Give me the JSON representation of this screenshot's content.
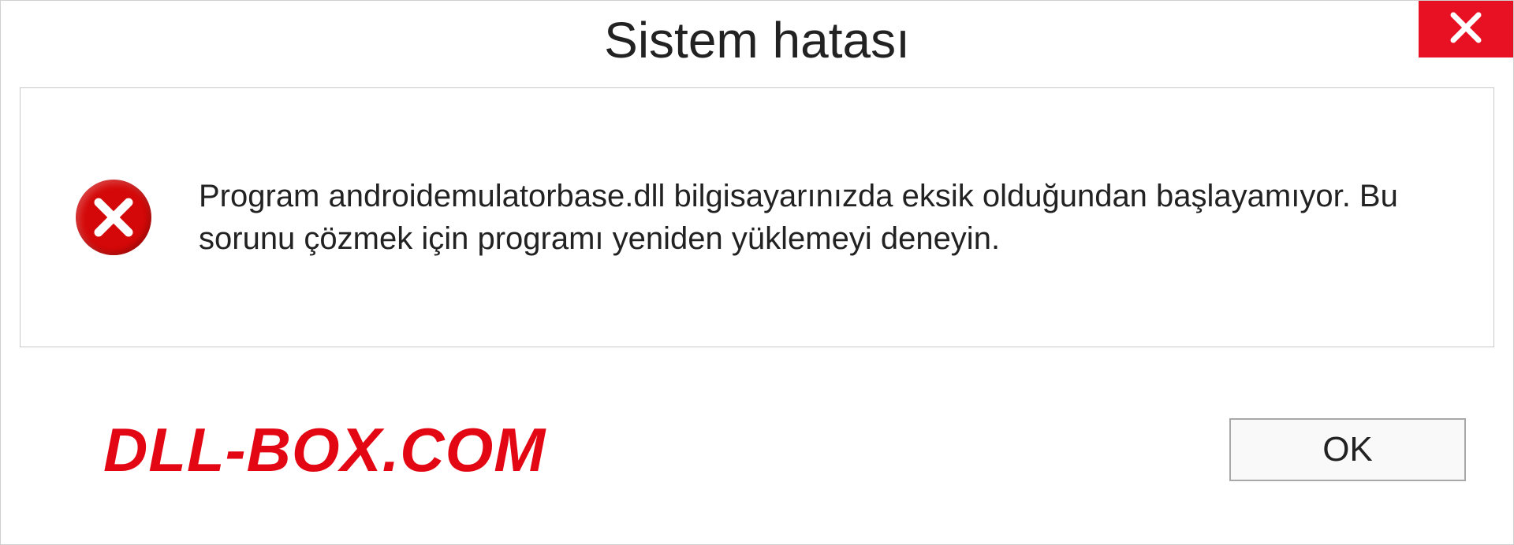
{
  "titlebar": {
    "title": "Sistem hatası"
  },
  "dialog": {
    "message": "Program androidemulatorbase.dll bilgisayarınızda eksik olduğundan başlayamıyor. Bu sorunu çözmek için programı yeniden yüklemeyi deneyin."
  },
  "footer": {
    "watermark": "DLL-BOX.COM",
    "ok_label": "OK"
  },
  "colors": {
    "close_bg": "#e81123",
    "error_bg": "#d40808",
    "watermark": "#e30613"
  }
}
